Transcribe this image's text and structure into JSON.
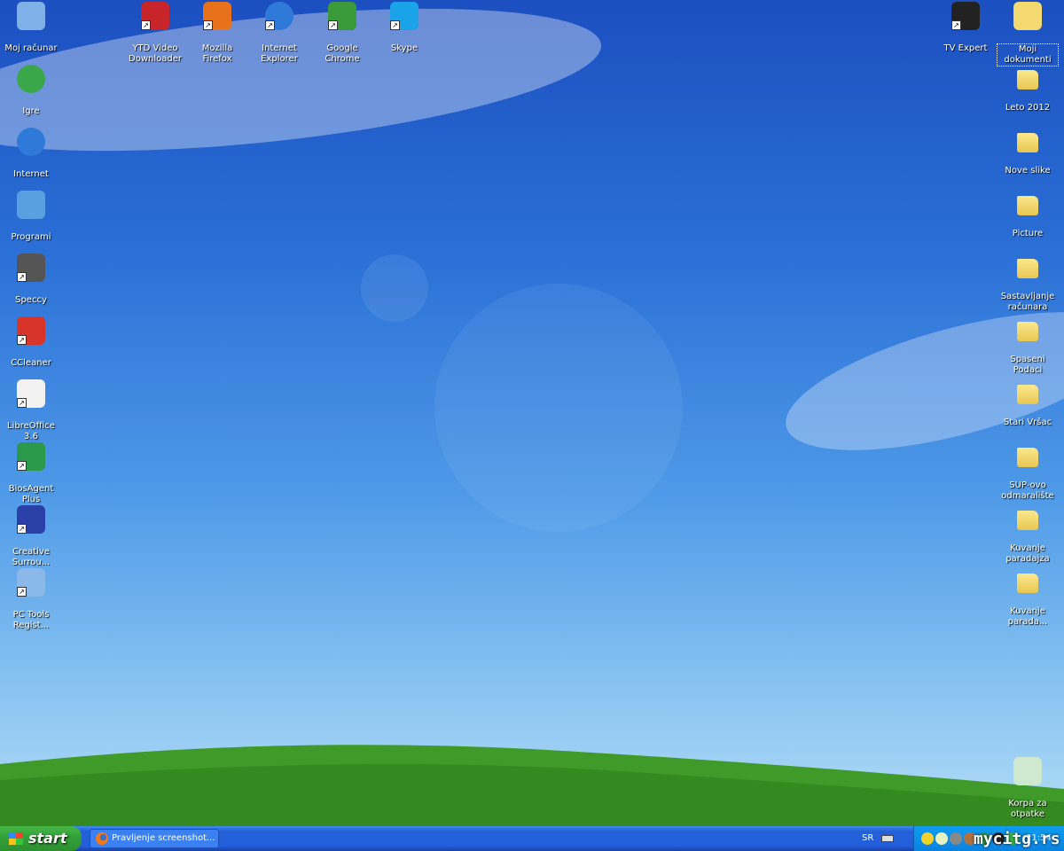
{
  "desktop_icons": [
    {
      "label": "Moj računar",
      "type": "computer",
      "color": "#7fb0e8",
      "shortcut": false
    },
    {
      "label": "Igre",
      "type": "games",
      "color": "#3aa84a",
      "shortcut": false
    },
    {
      "label": "Internet",
      "type": "ie",
      "color": "#2f7ad8",
      "shortcut": false
    },
    {
      "label": "Programi",
      "type": "programs",
      "color": "#5aa0e0",
      "shortcut": false
    },
    {
      "label": "Speccy",
      "type": "app",
      "color": "#555555",
      "shortcut": true
    },
    {
      "label": "CCleaner",
      "type": "app",
      "color": "#d8352a",
      "shortcut": true
    },
    {
      "label": "LibreOffice 3.6",
      "type": "doc",
      "color": "#f2f2f2",
      "shortcut": true
    },
    {
      "label": "BiosAgent Plus",
      "type": "app",
      "color": "#2a9a4a",
      "shortcut": true
    },
    {
      "label": "Creative Surrou...",
      "type": "app",
      "color": "#2b3fa8",
      "shortcut": true
    },
    {
      "label": "PC Tools Regist...",
      "type": "app",
      "color": "#8ab8e8",
      "shortcut": true
    },
    {
      "label": "YTD Video Downloader",
      "type": "app",
      "color": "#c8252a",
      "shortcut": true
    },
    {
      "label": "Mozilla Firefox",
      "type": "app",
      "color": "#e8711c",
      "shortcut": true
    },
    {
      "label": "Internet Explorer",
      "type": "ie",
      "color": "#2f7ad8",
      "shortcut": true
    },
    {
      "label": "Google Chrome",
      "type": "app",
      "color": "#3a9a3a",
      "shortcut": true
    },
    {
      "label": "Skype",
      "type": "app",
      "color": "#1aa3e8",
      "shortcut": true
    },
    {
      "label": "TV Expert",
      "type": "app",
      "color": "#222222",
      "shortcut": true
    },
    {
      "label": "Moji dokumenti",
      "type": "mydocs",
      "color": "#f4d870",
      "shortcut": false,
      "selected": true
    },
    {
      "label": "Leto 2012",
      "type": "folder"
    },
    {
      "label": "Nove slike",
      "type": "folder"
    },
    {
      "label": "Picture",
      "type": "folder"
    },
    {
      "label": "Sastavljanje računara",
      "type": "folder"
    },
    {
      "label": "Spaseni Podaci",
      "type": "folder"
    },
    {
      "label": "Stari Vršac",
      "type": "folder"
    },
    {
      "label": "SUP-ovo odmaralište",
      "type": "folder"
    },
    {
      "label": "Kuvanje paradajza",
      "type": "folder"
    },
    {
      "label": "Kuvanje parada...",
      "type": "folder"
    },
    {
      "label": "Korpa za otpatke",
      "type": "recycle",
      "color": "#cfe8d0",
      "shortcut": false
    }
  ],
  "taskbar": {
    "start_label": "start",
    "task": "Pravljenje screenshot...",
    "language": "SR",
    "clock": "21:54",
    "tray_icons": [
      "shield-icon",
      "cloud-icon",
      "speaker-icon",
      "network-icon",
      "app-icon",
      "tv-icon",
      "update-icon"
    ],
    "tray_colors": [
      "#f2d12a",
      "#e8f2c0",
      "#888888",
      "#b07040",
      "#2a9a4a",
      "#222222",
      "#3ab84a"
    ]
  },
  "watermark": "mycitg.rs"
}
